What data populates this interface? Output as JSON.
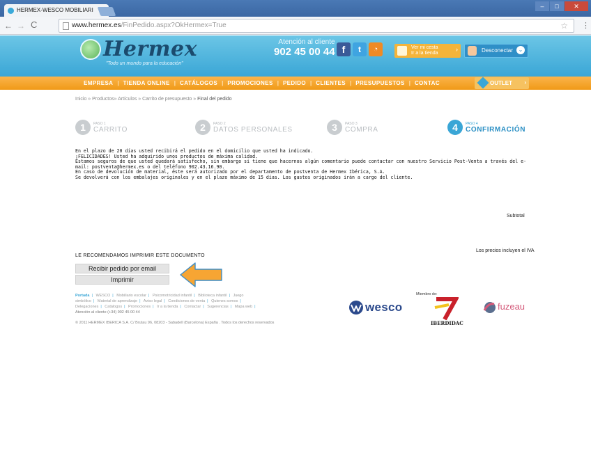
{
  "browser": {
    "tab_title": "HERMEX-WESCO MOBILIARI",
    "tab_close": "×",
    "url_domain": "www.hermex.es",
    "url_path": "/FinPedido.aspx?OkHermex=True"
  },
  "header": {
    "logo": "Hermex",
    "slogan": "\"Todo un mundo para la educación\"",
    "contact_label": "Atención al cliente",
    "phone": "902 45 00 44",
    "cart_button_line1": "Ver mi cesta",
    "cart_button_line2": "Ir a la tienda",
    "logout_button": "Desconectar"
  },
  "menu": {
    "items": [
      "EMPRESA",
      "TIENDA ONLINE",
      "CATÁLOGOS",
      "PROMOCIONES",
      "PEDIDO",
      "CLIENTES",
      "PRESUPUESTOS",
      "CONTAC"
    ],
    "outlet": "OUTLET"
  },
  "breadcrumb": {
    "trail": "Inicio »  Productos»  Artículos »  Carrito de presupuesto »",
    "current": "Final del pedido"
  },
  "steps": [
    {
      "num": "1",
      "small": "PASO 1",
      "label": "CARRITO"
    },
    {
      "num": "2",
      "small": "PASO 2",
      "label": "DATOS PERSONALES"
    },
    {
      "num": "3",
      "small": "PASO 3",
      "label": "COMPRA"
    },
    {
      "num": "4",
      "small": "PASO 4",
      "label": "CONFIRMACIÓN"
    }
  ],
  "message": {
    "line1": "En el plazo de 20 días usted recibirá el pedido en el domicilio que usted ha indicado.",
    "line2": "¡FELICIDADES! Usted ha adquirido unos productos de máxima calidad.",
    "line3": "Estamos seguros de que usted quedará satisfecho, sin embargo si tiene que hacernos algún comentario puede contactar con nuestro Servicio Post-Venta a través del e-",
    "line4": "mail: postventa@hermex.es o del teléfono 902.43.16.90.",
    "line5": "En caso de devolución de material, éste será autorizado por el departamento de postventa de Hermex Ibérica, S.A.",
    "line6": "Se devolverá con los embalajes originales y en el plazo máximo de 15 días. Los gastos originados irán a cargo del cliente."
  },
  "subtotal_label": "Subtotal",
  "iva_note": "Los precios incluyen el IVA",
  "recommend": "LE RECOMENDAMOS IMPRIMIR ESTE DOCUMENTO",
  "buttons": {
    "email": "Recibir pedido por email",
    "print": "Imprimir"
  },
  "footer": {
    "links_line1": [
      "Portada",
      "WESCO",
      "Mobiliario escolar",
      "Psicomotricidad infantil",
      "Biblioteca infantil",
      "Juego"
    ],
    "links_line2": [
      "simbólico",
      "Material de aprendizaje",
      "Aviso legal",
      "Condiciones de venta",
      "Quienes somos"
    ],
    "links_line3": [
      "Delegaciones",
      "Catálogos",
      "Promociones",
      "Ir a la tienda",
      "Contactar",
      "Sugerencias",
      "Mapa web"
    ],
    "attention": "Atención al cliente (+34) 902 45 00 44",
    "copyright": "© 2011 HERMEX IBERICA S.A. C/ Brutau 96, 08203 - Sabadell (Barcelona) España  . Todos los derechos reservados"
  },
  "partners": {
    "wesco": "wesco",
    "miembro": "Miembro de:",
    "iberdidac": "IBERDIDAC",
    "fuzeau": "fuzeau"
  },
  "colors": {
    "header_blue": "#3aa6d6",
    "menu_orange": "#f09a17",
    "highlight_arrow": "#f7a533"
  }
}
